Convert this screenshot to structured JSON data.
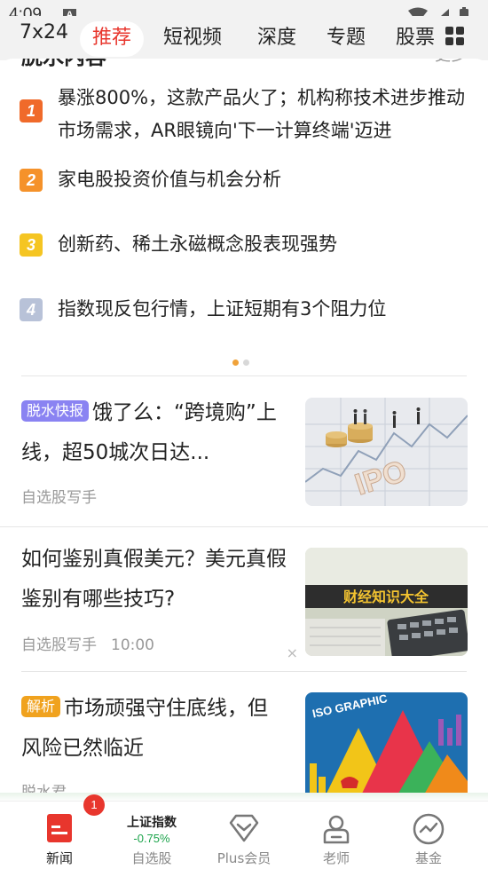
{
  "status_bar": {
    "time": "4:09",
    "notification_icon": "A"
  },
  "top_tabs": [
    {
      "label": "7x24",
      "active": false
    },
    {
      "label": "推荐",
      "active": true
    },
    {
      "label": "短视频",
      "active": false
    },
    {
      "label": "深度",
      "active": false
    },
    {
      "label": "专题",
      "active": false
    },
    {
      "label": "股票",
      "active": false
    }
  ],
  "hot_section": {
    "title": "脱水内容",
    "more_label": "更多",
    "items": [
      {
        "rank": "1",
        "color": "#f06a2a",
        "text": "暴涨800%，这款产品火了；机构称技术进步推动市场需求，AR眼镜向'下一计算终端'迈进"
      },
      {
        "rank": "2",
        "color": "#f5922a",
        "text": "家电股投资价值与机会分析"
      },
      {
        "rank": "3",
        "color": "#f5c522",
        "text": "创新药、稀土永磁概念股表现强势"
      },
      {
        "rank": "4",
        "color": "#b8c2d8",
        "text": "指数现反包行情，上证短期有3个阻力位"
      }
    ],
    "page_dots": {
      "active_color": "#f0a23a",
      "inactive_color": "#d8d8d8"
    }
  },
  "news": [
    {
      "badge": "脱水快报",
      "badge_color": "#8a83f2",
      "title": "饿了么：“跨境购”上线，超50城次日达...",
      "source": "自选股写手",
      "time": "",
      "image": "ipo-coins-image"
    },
    {
      "badge": "",
      "badge_color": "",
      "title": "如何鉴别真假美元？美元真假鉴别有哪些技巧?",
      "source": "自选股写手",
      "time": "10:00",
      "image": "finance-knowledge-image",
      "image_caption": "财经知识大全"
    },
    {
      "badge": "解析",
      "badge_color": "#f0a21e",
      "title": "市场顽强守住底线，但风险已然临近",
      "source": "脱水君",
      "time": "",
      "image": "iso-graphic-image",
      "image_caption": "ISO GRAPHIC"
    }
  ],
  "close_symbol": "×",
  "bottom_nav": {
    "news": {
      "label": "新闻",
      "badge": "1",
      "icon": "news-icon"
    },
    "stock": {
      "index_name": "上证指数",
      "index_change": "-0.75%",
      "label": "自选股"
    },
    "plus": {
      "label": "Plus会员",
      "icon": "diamond-icon"
    },
    "teacher": {
      "label": "老师",
      "icon": "teacher-icon"
    },
    "fund": {
      "label": "基金",
      "icon": "fund-icon"
    }
  }
}
